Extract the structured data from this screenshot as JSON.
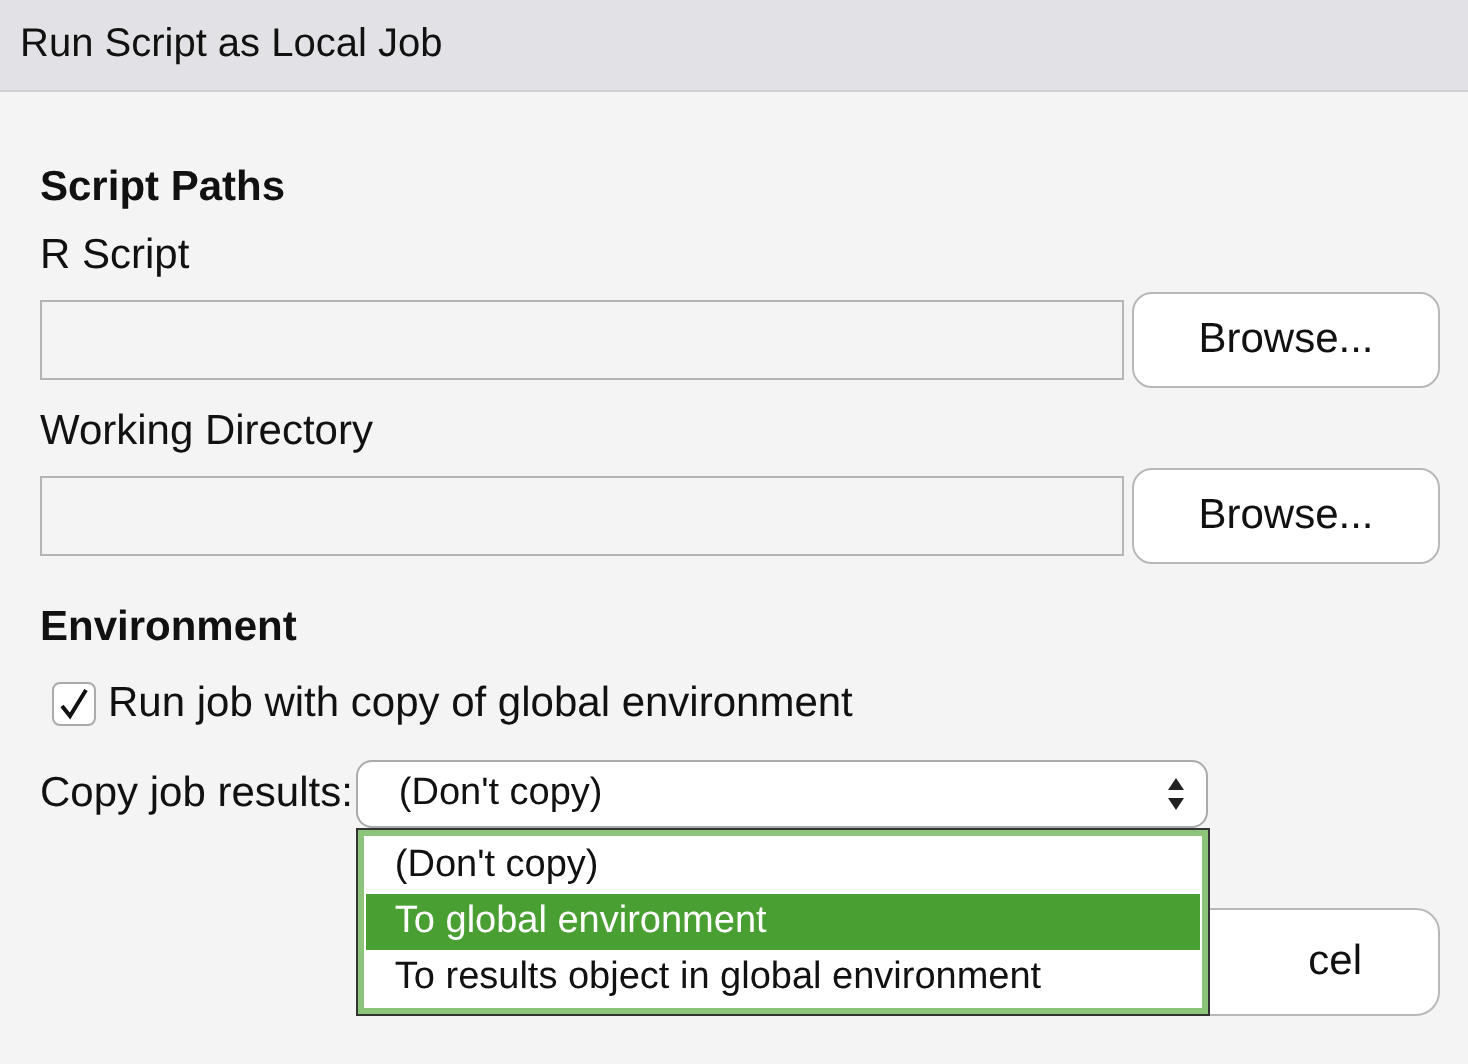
{
  "window": {
    "title": "Run Script as Local Job"
  },
  "script_paths": {
    "heading": "Script Paths",
    "fields": [
      {
        "label": "R Script",
        "button": "Browse..."
      },
      {
        "label": "Working Directory",
        "button": "Browse..."
      }
    ]
  },
  "environment": {
    "heading": "Environment",
    "checkbox": {
      "label": "Run job with copy of global environment",
      "checked": true
    },
    "copy_results": {
      "label": "Copy job results:",
      "value": "(Don't copy)",
      "expanded": true,
      "options": [
        {
          "label": "(Don't copy)",
          "highlighted": false
        },
        {
          "label": "To global environment",
          "highlighted": true
        },
        {
          "label": "To results object in global environment",
          "highlighted": false
        }
      ]
    }
  },
  "footer_button": {
    "label": "cel"
  }
}
